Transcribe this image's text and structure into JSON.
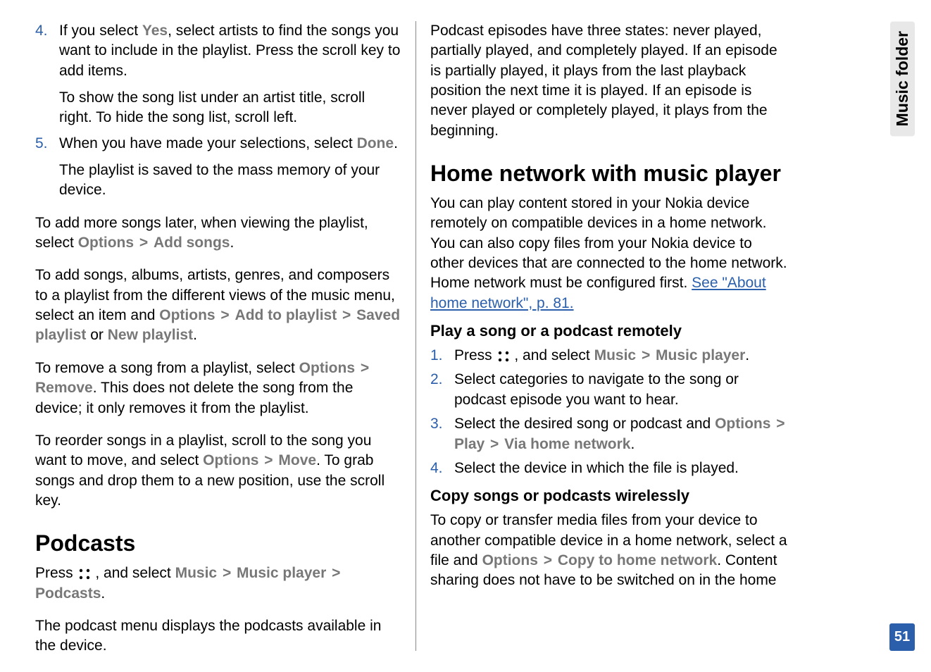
{
  "sidebar": {
    "tab": "Music folder",
    "page": "51"
  },
  "left": {
    "step4_num": "4.",
    "step4_a": "If you select ",
    "step4_yes": "Yes",
    "step4_b": ", select artists to find the songs you want to include in the playlist. Press the scroll key to add items.",
    "step4_sub": "To show the song list under an artist title, scroll right. To hide the song list, scroll left.",
    "step5_num": "5.",
    "step5_a": "When you have made your selections, select ",
    "step5_done": "Done",
    "step5_b": ".",
    "step5_sub": "The playlist is saved to the mass memory of your device.",
    "p1_a": "To add more songs later, when viewing the playlist, select ",
    "p1_opt": "Options",
    "p1_add": "Add songs",
    "p1_b": ".",
    "p2_a": "To add songs, albums, artists, genres, and composers to a playlist from the different views of the music menu, select an item and ",
    "p2_opt": "Options",
    "p2_addto": "Add to playlist",
    "p2_saved": "Saved playlist",
    "p2_or": " or ",
    "p2_new": "New playlist",
    "p2_b": ".",
    "p3_a": "To remove a song from a playlist, select ",
    "p3_opt": "Options",
    "p3_remove": "Remove",
    "p3_b": ". This does not delete the song from the device; it only removes it from the playlist.",
    "p4_a": "To reorder songs in a playlist, scroll to the song you want to move, and select ",
    "p4_opt": "Options",
    "p4_move": "Move",
    "p4_b": ". To grab songs and drop them to a new position, use the scroll key.",
    "h2_podcasts": "Podcasts",
    "pod_a": "Press ",
    "pod_b": " , and select ",
    "pod_music": "Music",
    "pod_player": "Music player",
    "pod_podcasts": "Podcasts",
    "pod_c": ".",
    "pod2": "The podcast menu displays the podcasts available in the device."
  },
  "right": {
    "intro": "Podcast episodes have three states: never played, partially played, and completely played. If an episode is partially played, it plays from the last playback position the next time it is played. If an episode is never played or completely played, it plays from the beginning.",
    "h2_home": "Home network with music player",
    "home_a": "You can play content stored in your Nokia device remotely on compatible devices in a home network. You can also copy files from your Nokia device to other devices that are connected to the home network. Home network must be configured first. ",
    "home_link": "See \"About home network\", p. 81.",
    "h3_play": "Play a song or a podcast remotely",
    "s1_num": "1.",
    "s1_a": "Press ",
    "s1_b": " , and select ",
    "s1_music": "Music",
    "s1_player": "Music player",
    "s1_c": ".",
    "s2_num": "2.",
    "s2": "Select categories to navigate to the song or podcast episode you want to hear.",
    "s3_num": "3.",
    "s3_a": "Select the desired song or podcast and ",
    "s3_opt": "Options",
    "s3_play": "Play",
    "s3_via": "Via home network",
    "s3_b": ".",
    "s4_num": "4.",
    "s4": "Select the device in which the file is played.",
    "h3_copy": "Copy songs or podcasts wirelessly",
    "copy_a": "To copy or transfer media files from your device to another compatible device in a home network, select a file and ",
    "copy_opt": "Options",
    "copy_to": "Copy to home network",
    "copy_b": ". Content sharing does not have to be switched on in the home"
  }
}
